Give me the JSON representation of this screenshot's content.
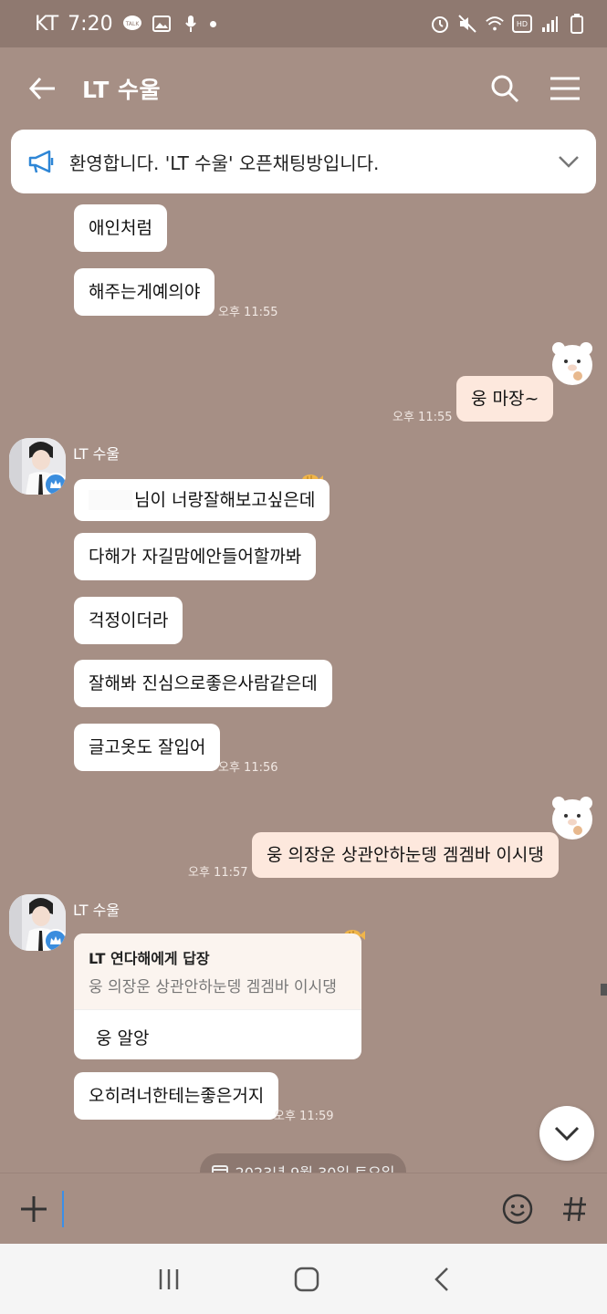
{
  "status_bar": {
    "carrier": "KT",
    "time": "7:20",
    "talk_icon": "talk-icon",
    "hd_label": "HD",
    "battery_label": "7"
  },
  "header": {
    "title": "LT 수울",
    "back_icon": "back-arrow-icon",
    "search_icon": "search-icon",
    "menu_icon": "menu-icon"
  },
  "notice": {
    "text": "환영합니다. 'LT 수울' 오픈채팅방입니다."
  },
  "messages": {
    "m1": "애인처럼",
    "m2": "해주는게예의야",
    "t2": "오후 11:55",
    "m3": "웅 마장~",
    "t3": "오후 11:55",
    "sender1": "LT 수울",
    "m4": "님이 너랑잘해보고싶은데",
    "m5": "다해가 자길맘에안들어할까봐",
    "m6": "걱정이더라",
    "m7": "잘해봐 진심으로좋은사람같은데",
    "m8": "글고옷도 잘입어",
    "t8": "오후 11:56",
    "m9": "웅 의장운 상관안하눈뎅 겜겜바 이시댕",
    "t9": "오후 11:57",
    "sender2": "LT 수울",
    "reply_name": "LT 연다해에게 답장",
    "reply_quote": "웅 의장운 상관안하눈뎅 겜겜바 이시댕",
    "reply_text": "웅 알앙",
    "m11": "오히려너한테는좋은거지",
    "t11": "오후 11:59"
  },
  "date_divider": "2023년 9월 30일 토요일",
  "input": {
    "placeholder": "",
    "value": ""
  },
  "colors": {
    "background": "#a68f85",
    "status_bar": "#8f7970",
    "bubble_other": "#ffffff",
    "bubble_mine": "#fde8dd",
    "badge_blue": "#3a8dde"
  }
}
